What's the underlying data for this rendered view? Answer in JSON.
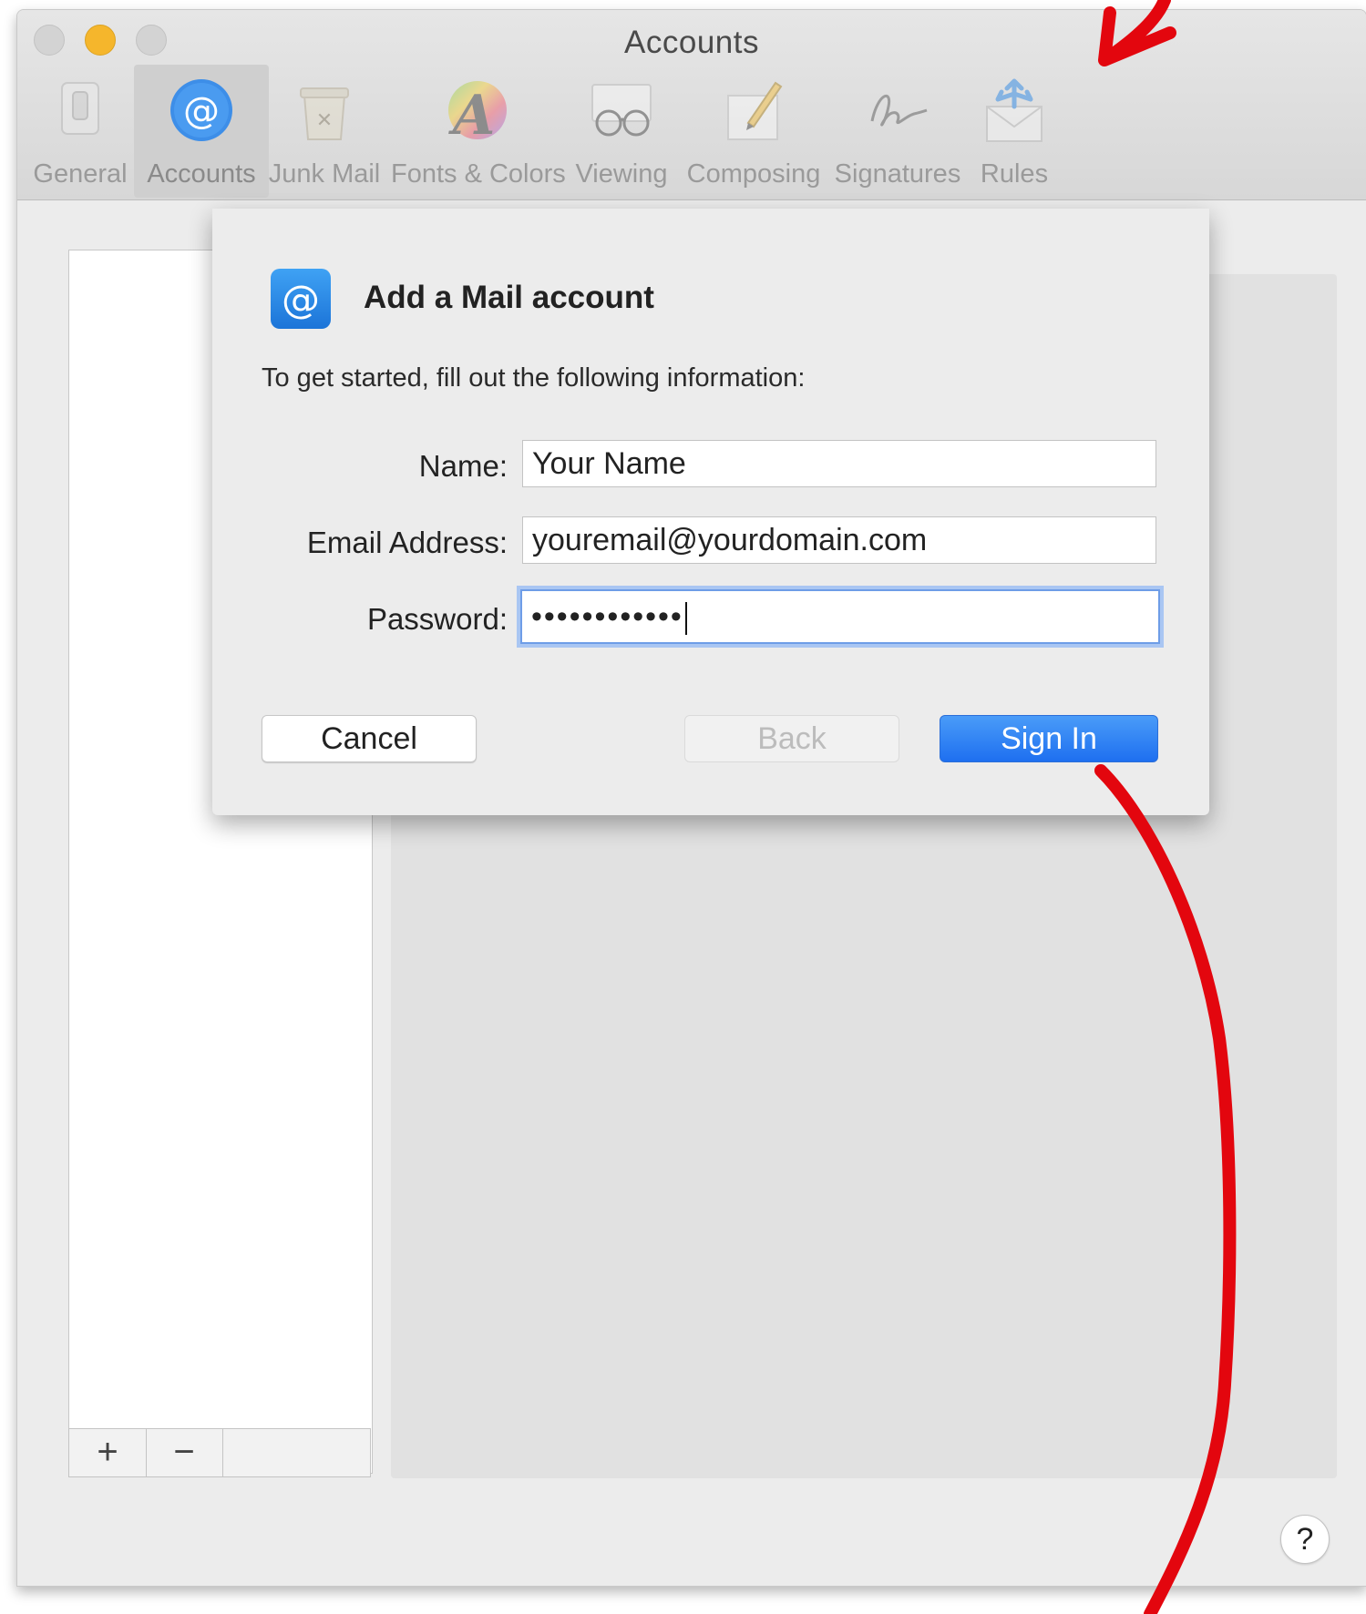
{
  "window": {
    "title": "Accounts"
  },
  "toolbar": {
    "items": [
      {
        "label": "General",
        "icon": "general-switch-icon"
      },
      {
        "label": "Accounts",
        "icon": "at-sign-icon",
        "selected": true
      },
      {
        "label": "Junk Mail",
        "icon": "junk-mail-trash-icon"
      },
      {
        "label": "Fonts & Colors",
        "icon": "fonts-colors-icon"
      },
      {
        "label": "Viewing",
        "icon": "glasses-icon"
      },
      {
        "label": "Composing",
        "icon": "pencil-paper-icon"
      },
      {
        "label": "Signatures",
        "icon": "signature-icon"
      },
      {
        "label": "Rules",
        "icon": "rules-envelope-icon"
      }
    ]
  },
  "sheet": {
    "title": "Add a Mail account",
    "subtitle": "To get started, fill out the following information:",
    "fields": {
      "name_label": "Name:",
      "name_value": "Your Name",
      "email_label": "Email Address:",
      "email_value": "youremail@yourdomain.com",
      "password_label": "Password:",
      "password_value": "••••••••••••"
    },
    "buttons": {
      "cancel": "Cancel",
      "back": "Back",
      "sign_in": "Sign In"
    }
  },
  "account_list": {
    "add_label": "+",
    "remove_label": "−"
  },
  "help_label": "?",
  "colors": {
    "accent": "#1e6ff0",
    "focus_ring": "#a9c6f3",
    "annotation": "#e3060e",
    "minimize_light": "#f5b62c"
  }
}
